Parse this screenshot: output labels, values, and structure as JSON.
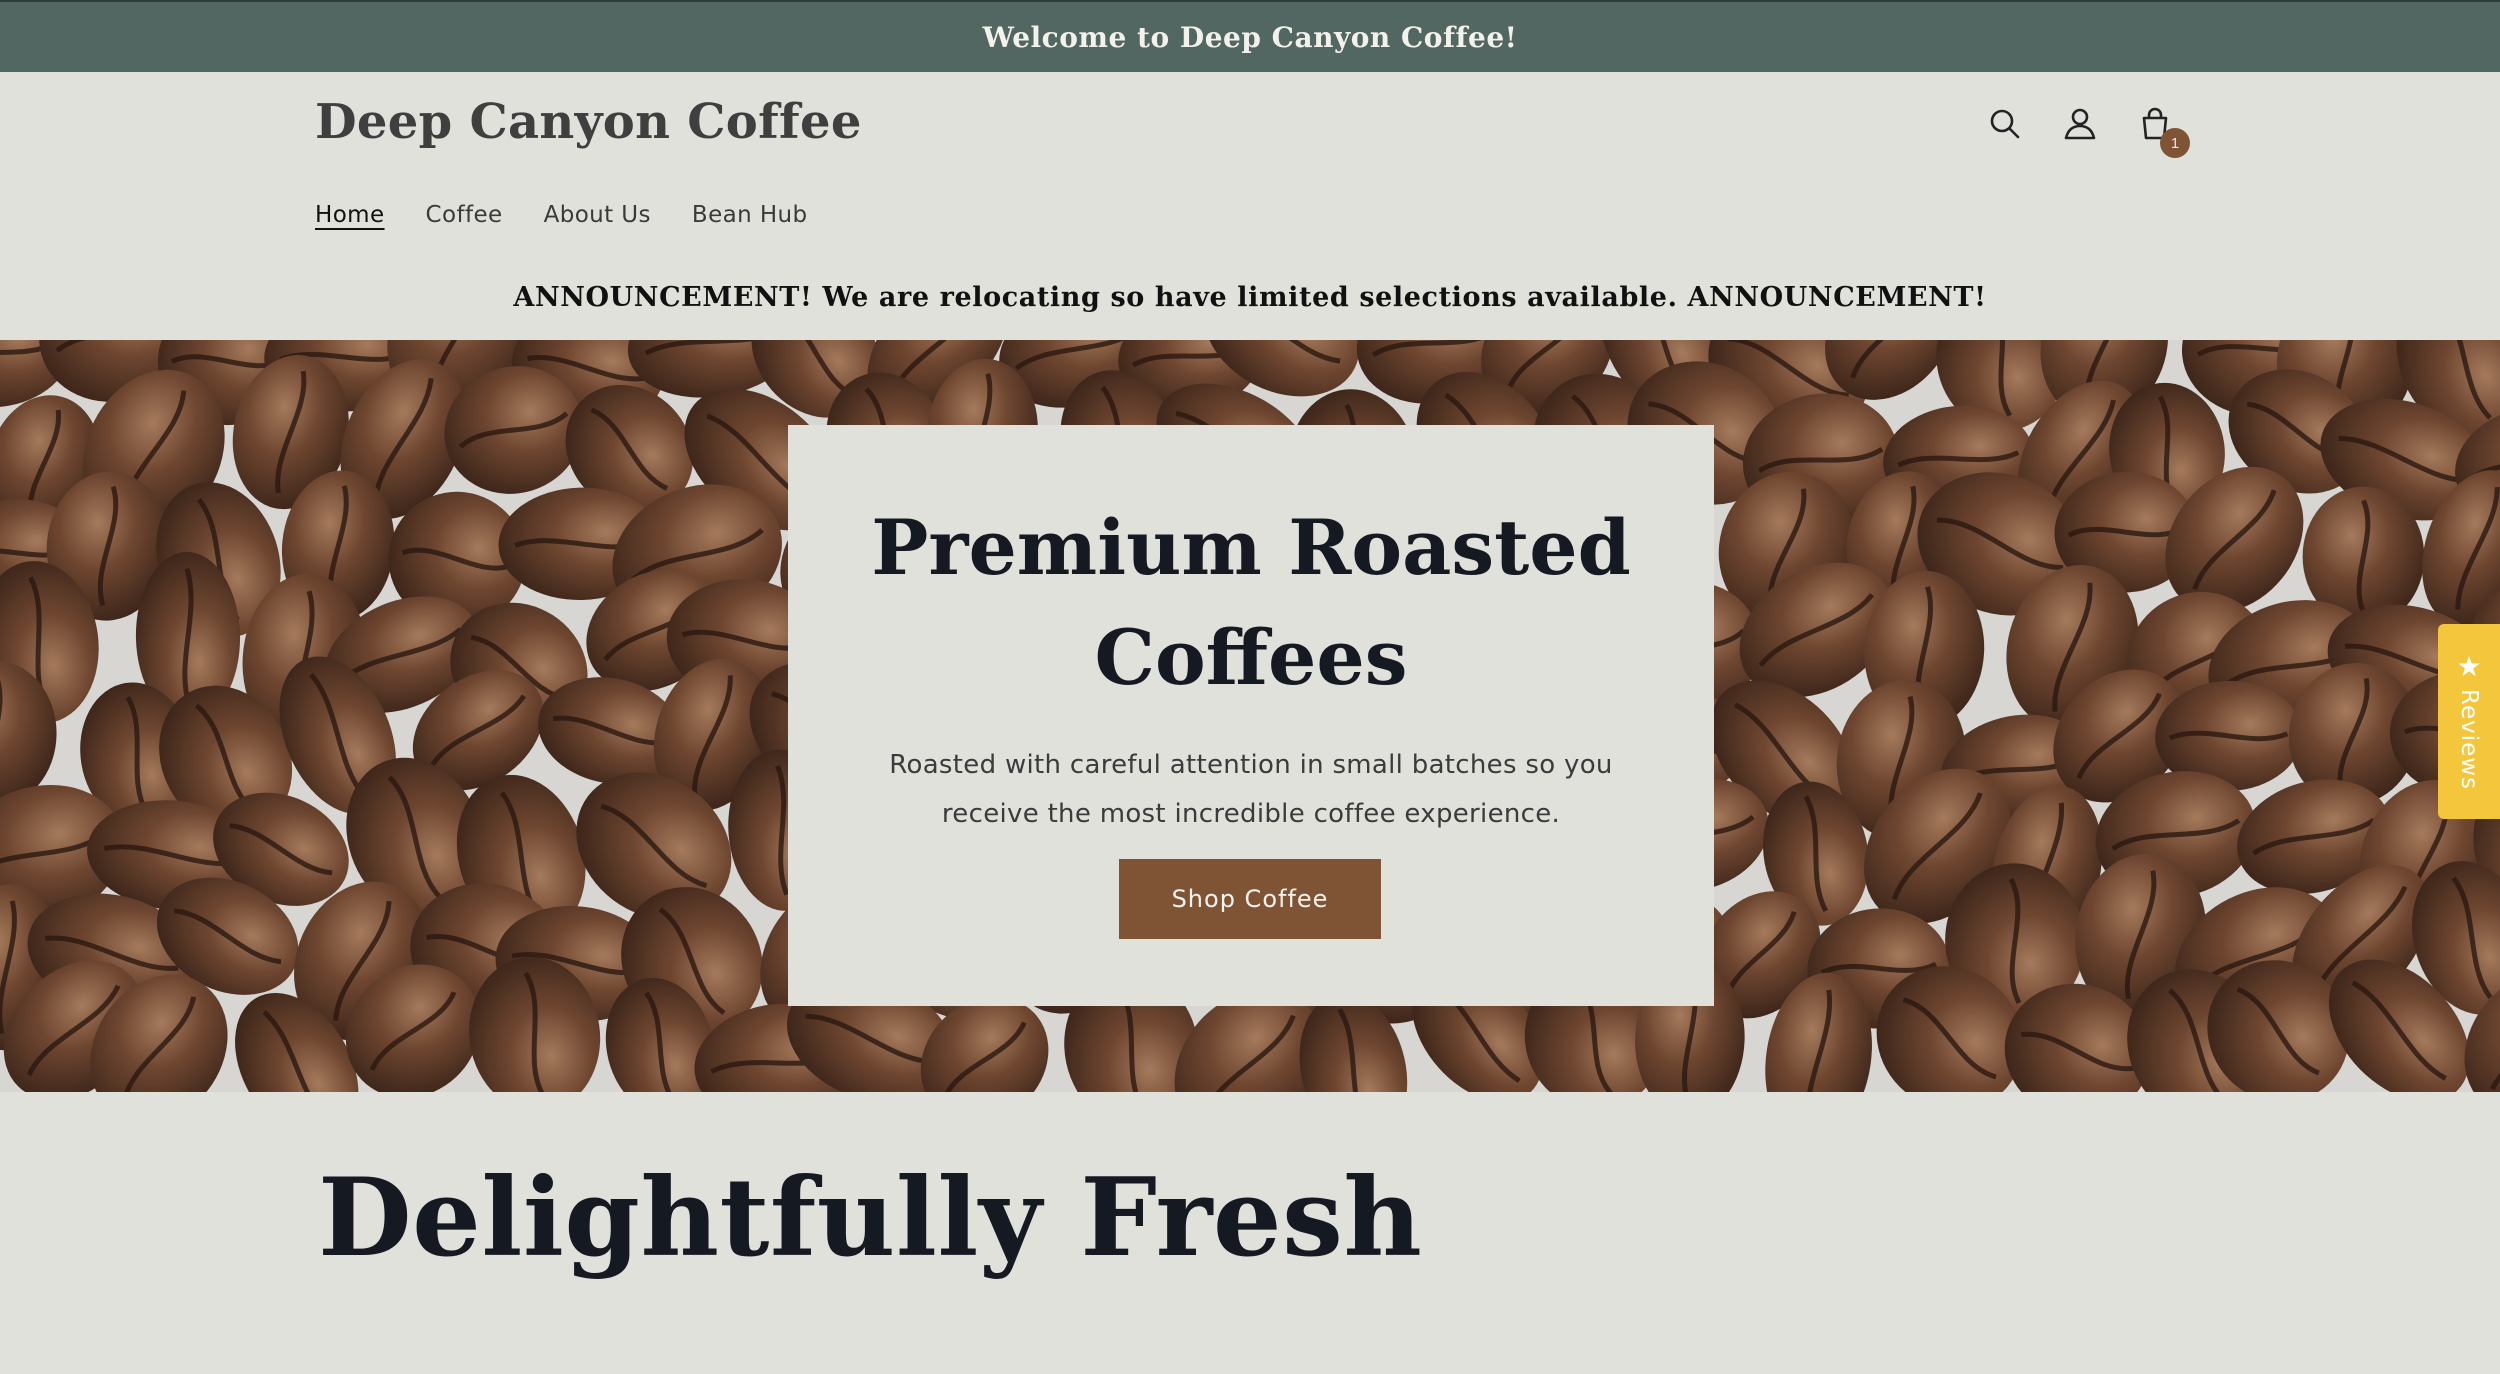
{
  "topbar": {
    "welcome": "Welcome to Deep Canyon Coffee!"
  },
  "header": {
    "logo": "Deep Canyon Coffee",
    "icons": [
      "search-icon",
      "account-icon",
      "cart-icon"
    ],
    "cart_count": "1",
    "nav": [
      {
        "label": "Home",
        "active": true
      },
      {
        "label": "Coffee"
      },
      {
        "label": "About Us"
      },
      {
        "label": "Bean Hub"
      }
    ]
  },
  "announcement": "ANNOUNCEMENT! We are relocating so have limited selections available. ANNOUNCEMENT!",
  "hero": {
    "title": "Premium Roasted Coffees",
    "subtitle": "Roasted with careful attention in small batches so you receive the most incredible coffee experience.",
    "cta": "Shop Coffee"
  },
  "reviews_tab": {
    "label": "Reviews",
    "icon": "star-icon"
  },
  "section": {
    "title": "Delightfully Fresh"
  },
  "colors": {
    "topbar": "#526761",
    "background": "#e1e1dc",
    "accent": "#7f5435",
    "reviews": "#f3c63b",
    "heading": "#151a22"
  }
}
